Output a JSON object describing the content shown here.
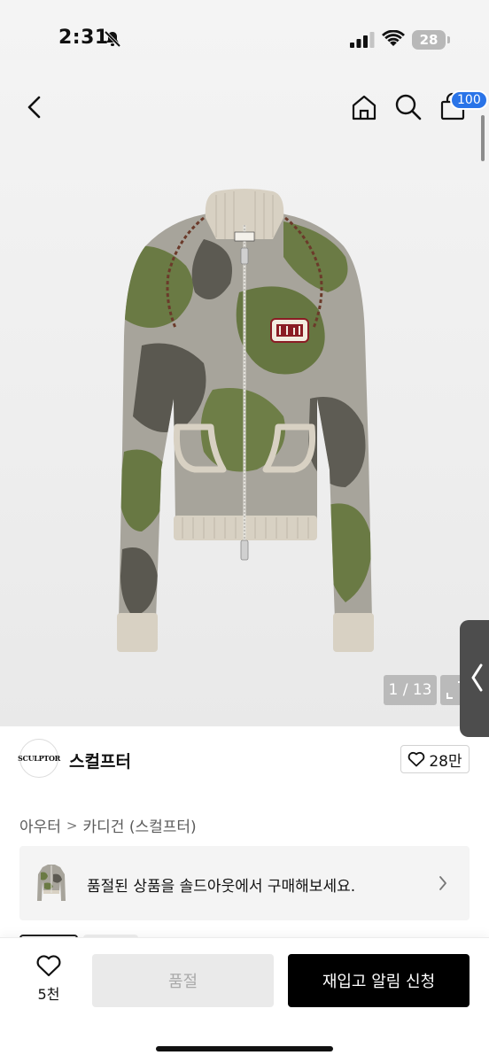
{
  "status_bar": {
    "time": "2:31",
    "battery": "28"
  },
  "nav": {
    "cart_count": "100"
  },
  "gallery": {
    "counter": "1 / 13"
  },
  "brand": {
    "logo_text": "SCULPTOR",
    "name": "스컬프터",
    "likes": "28만"
  },
  "breadcrumb": {
    "level1": "아우터",
    "separator": ">",
    "level2": "카디건 (스컬프터)"
  },
  "promo": {
    "text": "품절된 상품을 솔드아웃에서 구매해보세요."
  },
  "bottom_bar": {
    "wish_count": "5천",
    "soldout_label": "품절",
    "restock_label": "재입고 알림 신청"
  },
  "colors": {
    "accent": "#2a74e8",
    "primary_button": "#000000",
    "disabled_button": "#eaeaea"
  }
}
